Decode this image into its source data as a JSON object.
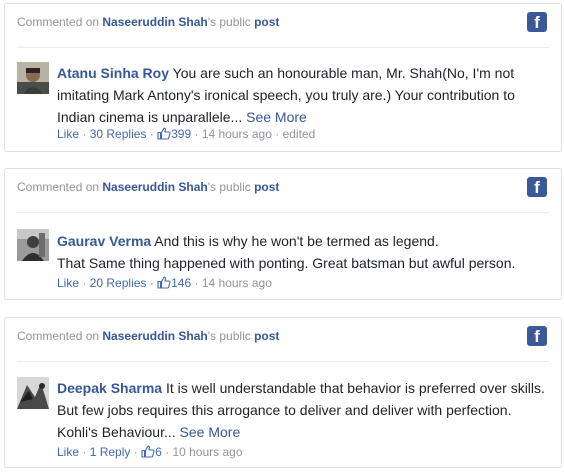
{
  "comments": [
    {
      "header": {
        "prefix": "Commented on",
        "page_name": "Naseeruddin Shah",
        "suffix": "'s public",
        "post_link": "post"
      },
      "author": "Atanu Sinha Roy",
      "lines": [
        "You are such an honourable man, Mr. Shah(No, I'm not",
        "imitating Mark Antony's ironical speech, you truly are.) Your contribution to",
        "Indian cinema is unparallele..."
      ],
      "see_more": "See More",
      "like_label": "Like",
      "replies_label": "30 Replies",
      "reactions_count": "399",
      "time": "14 hours ago",
      "edited": "edited"
    },
    {
      "header": {
        "prefix": "Commented on",
        "page_name": "Naseeruddin Shah",
        "suffix": "'s public",
        "post_link": "post"
      },
      "author": "Gaurav Verma",
      "lines": [
        "And this is why he won't be termed as legend.",
        "That Same thing happened with ponting. Great batsman but awful person."
      ],
      "like_label": "Like",
      "replies_label": "20 Replies",
      "reactions_count": "146",
      "time": "14 hours ago"
    },
    {
      "header": {
        "prefix": "Commented on",
        "page_name": "Naseeruddin Shah",
        "suffix": "'s public",
        "post_link": "post"
      },
      "author": "Deepak Sharma",
      "lines": [
        "It is well understandable that behavior is preferred over skills.",
        "But few jobs requires this arrogance to deliver and deliver with perfection.",
        "Kohli's Behaviour..."
      ],
      "see_more": "See More",
      "like_label": "Like",
      "replies_label": "1 Reply",
      "reactions_count": "6",
      "time": "10 hours ago"
    }
  ],
  "icons": {
    "facebook": "f"
  },
  "colors": {
    "link": "#365899",
    "meta": "#90949c",
    "fb_blue": "#3b5998",
    "border": "#dddfe2"
  }
}
